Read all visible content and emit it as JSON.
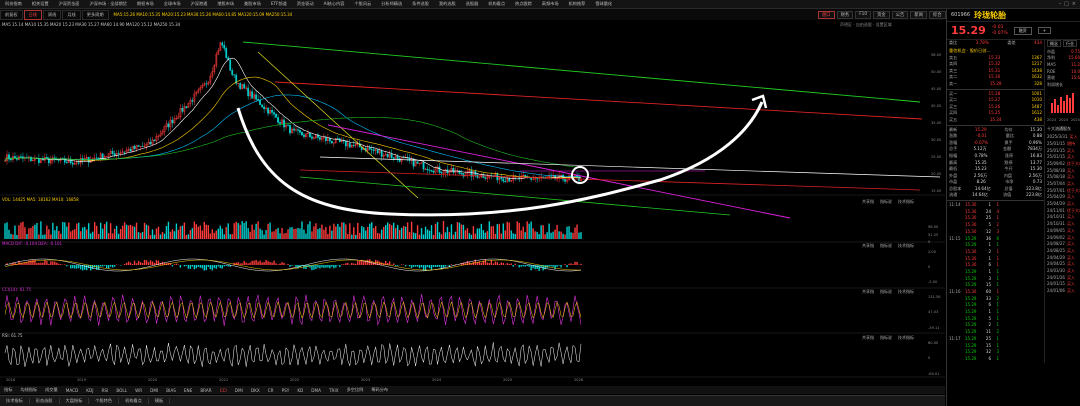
{
  "menu": {
    "items": [
      "科技指南",
      "相关设置",
      "沪深资金面",
      "沪深市场 · 全部期货",
      "期权市场",
      "全球市场",
      "沪深港通",
      "港股市场",
      "美股市场",
      "ETF频道",
      "资金驱动",
      "AI核心内容",
      "个股风云",
      "分析师精选",
      "条件选股",
      "我的选股",
      "选股器",
      "机构看点",
      "热点跟踪",
      "高频市场",
      "机构推荐",
      "雪球量化"
    ]
  },
  "toolbar": {
    "buttons": [
      "前复权",
      "日线",
      "周线",
      "月线",
      "更多周期"
    ],
    "active_index": 1,
    "ma_text": "MA5:15.26 MA10:15.35 MA20:15.23 MA30:15.26 MA60:14.85 MA120:15.09 MA250:15.34"
  },
  "right_tabs": {
    "items": [
      "盘口",
      "财务",
      "F10",
      "资金",
      "公告",
      "新闻",
      "综合"
    ],
    "active_index": 0
  },
  "price_header": {
    "ma_line": "MA5 15.14  MA10 15.35  MA20 15.23  MA30 15.27  MA60 14.90  MA120 15.12  MA250 15.34",
    "right_hint": "声明区 · 自由选股 · 设置区域"
  },
  "price_axis": [
    "58.00",
    "50.00",
    "45.00",
    "40.00",
    "35.00",
    "30.00",
    "25.00",
    "20.00",
    "15.00",
    "10.00"
  ],
  "volume_header": "VOL: 14425  MA5: 18162  MA10: 16858",
  "macd_header": "MACD  DIF: -0.104  DEA: -0.101",
  "cci_header": "CCI(14): 61.75",
  "rsi_header": "RSI: 61.75",
  "sub_buttons": [
    "共享指",
    "指标说",
    "技术指标"
  ],
  "volume_axis": [
    "98.00",
    "51.25",
    "0"
  ],
  "macd_axis": [
    "2.00",
    "0",
    "-2.00"
  ],
  "cci_axis": [
    "131.58",
    "47.03",
    "-39.11"
  ],
  "rsi_axis": [
    "60.00",
    "0",
    "-60.01"
  ],
  "years": [
    "2018",
    "2019",
    "2020",
    "2021",
    "2022",
    "2023",
    "2024",
    "2025",
    "2026"
  ],
  "indicator_tabs": {
    "items": [
      "指标",
      "均线指标",
      "成交量",
      "MACD",
      "KDJ",
      "RSI",
      "BOLL",
      "WR",
      "DMI",
      "BIAS",
      "ENE",
      "BRAR",
      "CCI",
      "DMI",
      "DKX",
      "CR",
      "PSY",
      "KD",
      "DMA",
      "TRIX",
      "多空比例",
      "筹码分布"
    ],
    "active_index": 12
  },
  "status_tabs": [
    "技术指标",
    "形态选股",
    "大盘指标",
    "个股特色",
    "机构看点",
    "模板"
  ],
  "stock": {
    "code": "601966",
    "name": "玲珑轮胎",
    "price": "15.29",
    "change": "-0.01",
    "change_pct": "-0.07%",
    "btn_buy": "融资",
    "btn_add": "+"
  },
  "order_book": {
    "top_labels": [
      "委比",
      "3.78%",
      "委差",
      "434"
    ],
    "sell": [
      {
        "l": "卖五",
        "p": "15.33",
        "v": "1367"
      },
      {
        "l": "卖四",
        "p": "15.32",
        "v": "1217"
      },
      {
        "l": "卖三",
        "p": "15.31",
        "v": "1438"
      },
      {
        "l": "卖二",
        "p": "15.30",
        "v": "1632"
      },
      {
        "l": "卖一",
        "p": "15.29",
        "v": "328"
      }
    ],
    "buy": [
      {
        "l": "买一",
        "p": "15.28",
        "v": "1001"
      },
      {
        "l": "买二",
        "p": "15.27",
        "v": "1010"
      },
      {
        "l": "买三",
        "p": "15.26",
        "v": "1487"
      },
      {
        "l": "买四",
        "p": "15.25",
        "v": "1612"
      },
      {
        "l": "买五",
        "p": "15.24",
        "v": "438"
      }
    ],
    "tag": "重估机会 · 股价已创…"
  },
  "quote_stats": [
    {
      "a": "最新",
      "b": "15.29",
      "c": "均价",
      "d": "15.30"
    },
    {
      "a": "涨跌",
      "b": "-0.01",
      "c": "量比",
      "d": "0.88"
    },
    {
      "a": "涨幅",
      "b": "-0.07%",
      "c": "换手",
      "d": "0.96%"
    },
    {
      "a": "总手",
      "b": "5.12万",
      "c": "金额",
      "d": "7834万"
    },
    {
      "a": "振幅",
      "b": "0.78%",
      "c": "涨停",
      "d": "16.83"
    },
    {
      "a": "最高",
      "b": "15.35",
      "c": "跌停",
      "d": "13.77"
    },
    {
      "a": "最低",
      "b": "15.23",
      "c": "今开",
      "d": "15.30"
    },
    {
      "a": "外盘",
      "b": "2.56万",
      "c": "内盘",
      "d": "2.56万"
    },
    {
      "a": "市盈",
      "b": "8.26",
      "c": "市净",
      "d": "0.73"
    },
    {
      "a": "总股本",
      "b": "14.64亿",
      "c": "总值",
      "d": "223.8亿"
    },
    {
      "a": "流通",
      "b": "14.64亿",
      "c": "流值",
      "d": "223.8亿"
    }
  ],
  "right_mini": {
    "tabs": [
      "概念",
      "行业"
    ],
    "labels": [
      "市盈",
      "0.75",
      "净利",
      "15.60",
      "MA5",
      "11.2",
      "ROE",
      "10.0",
      "营收",
      "15.6"
    ],
    "chart_label": "利润增长",
    "years": [
      "2023",
      "2024",
      "2025"
    ],
    "sub_label": "十大流通股东"
  },
  "ticks": [
    {
      "t": "11:14",
      "p": "15.30",
      "v": "1",
      "n": "1"
    },
    {
      "t": "",
      "p": "15.30",
      "v": "24",
      "n": "4"
    },
    {
      "t": "",
      "p": "15.30",
      "v": "25",
      "n": "1"
    },
    {
      "t": "",
      "p": "15.30",
      "v": "5",
      "n": "2"
    },
    {
      "t": "",
      "p": "15.30",
      "v": "12",
      "n": "3"
    },
    {
      "t": "11:15",
      "p": "15.29",
      "v": "36",
      "n": "6"
    },
    {
      "t": "",
      "p": "15.29",
      "v": "1",
      "n": "1"
    },
    {
      "t": "",
      "p": "15.30",
      "v": "2",
      "n": "1"
    },
    {
      "t": "",
      "p": "15.30",
      "v": "1",
      "n": "1"
    },
    {
      "t": "",
      "p": "15.30",
      "v": "6",
      "n": "1"
    },
    {
      "t": "",
      "p": "15.29",
      "v": "1",
      "n": "1"
    },
    {
      "t": "",
      "p": "15.29",
      "v": "3",
      "n": "1"
    },
    {
      "t": "",
      "p": "15.29",
      "v": "15",
      "n": "1"
    },
    {
      "t": "11:16",
      "p": "15.30",
      "v": "60",
      "n": "1"
    },
    {
      "t": "",
      "p": "15.29",
      "v": "33",
      "n": "2"
    },
    {
      "t": "",
      "p": "15.29",
      "v": "6",
      "n": "1"
    },
    {
      "t": "",
      "p": "15.29",
      "v": "1",
      "n": "1"
    },
    {
      "t": "",
      "p": "15.29",
      "v": "5",
      "n": "1"
    },
    {
      "t": "",
      "p": "15.29",
      "v": "2",
      "n": "1"
    },
    {
      "t": "",
      "p": "15.29",
      "v": "11",
      "n": "2"
    },
    {
      "t": "11:17",
      "p": "15.29",
      "v": "25",
      "n": "1"
    },
    {
      "t": "",
      "p": "15.29",
      "v": "15",
      "n": "1"
    },
    {
      "t": "",
      "p": "15.29",
      "v": "32",
      "n": "3"
    },
    {
      "t": "",
      "p": "15.29",
      "v": "6",
      "n": "1"
    }
  ],
  "right_ticks": [
    {
      "d": "2025/3/31",
      "s": "买入"
    },
    {
      "d": "25/01/15",
      "s": "增持"
    },
    {
      "d": "25/01/15",
      "s": "买入"
    },
    {
      "d": "25/01/15",
      "s": "买入"
    },
    {
      "d": "25/09/02",
      "s": "优于大市"
    },
    {
      "d": "25/08/18",
      "s": "买入"
    },
    {
      "d": "25/08/18",
      "s": "买入"
    },
    {
      "d": "25/07/04",
      "s": "买入"
    },
    {
      "d": "25/07/01",
      "s": "优于大市"
    },
    {
      "d": "25/04/29",
      "s": "买入"
    },
    {
      "d": "25/04/29",
      "s": "买入"
    },
    {
      "d": "24/11/01",
      "s": "优于大市"
    },
    {
      "d": "24/10/31",
      "s": "买入"
    },
    {
      "d": "24/10/31",
      "s": "买入"
    },
    {
      "d": "24/09/05",
      "s": "买入"
    },
    {
      "d": "24/09/02",
      "s": "买入"
    },
    {
      "d": "24/08/27",
      "s": "买入"
    },
    {
      "d": "24/08/25",
      "s": "买入"
    },
    {
      "d": "24/04/29",
      "s": "买入"
    },
    {
      "d": "24/04/25",
      "s": "买入"
    },
    {
      "d": "24/03/30",
      "s": "买入"
    },
    {
      "d": "24/01/26",
      "s": "买入"
    },
    {
      "d": "24/01/15",
      "s": "买入"
    },
    {
      "d": "24/01/06",
      "s": "买入"
    }
  ],
  "colors": {
    "up": "#ff3b3b",
    "down": "#00d0d0",
    "accent": "#ffd000",
    "green_line": "#22cc22",
    "red_line": "#dd2222",
    "magenta_line": "#dd22dd",
    "yellow_line": "#e0e020",
    "white_line": "#ffffff"
  },
  "chart_data": {
    "type": "candlestick",
    "x": [
      "2018",
      "2019",
      "2020",
      "2021",
      "2022",
      "2023",
      "2024",
      "2025",
      "2026"
    ],
    "price_close": [
      22.0,
      20.5,
      26.0,
      50.5,
      30.0,
      25.0,
      18.0,
      15.3,
      15.29
    ],
    "ylim": [
      10,
      58
    ],
    "annotations": [
      "trend-lines",
      "u-shape-arrow",
      "circle-marker"
    ]
  }
}
